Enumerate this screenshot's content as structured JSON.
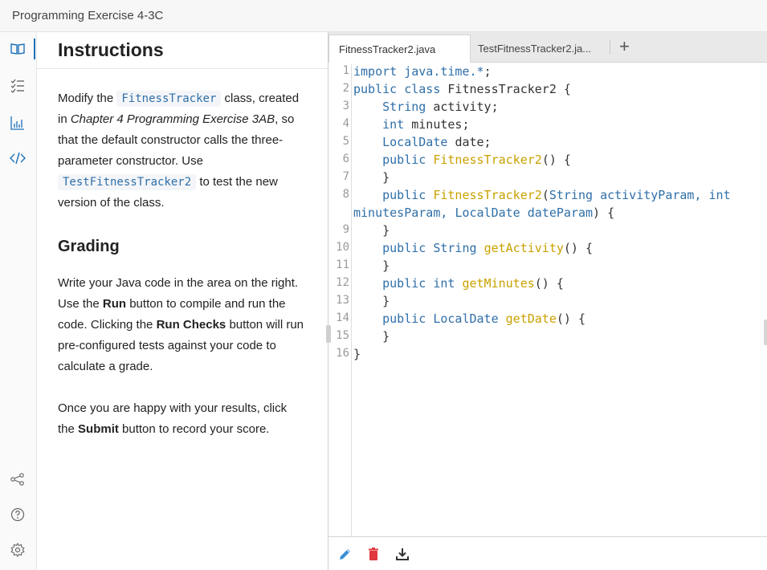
{
  "window": {
    "title": "Programming Exercise 4-3C"
  },
  "rail": {
    "icons": [
      "book-icon",
      "checklist-icon",
      "chart-icon",
      "code-icon",
      "share-icon",
      "help-icon",
      "settings-icon"
    ]
  },
  "instructions": {
    "heading": "Instructions",
    "p1_a": "Modify the ",
    "p1_code1": "FitnessTracker",
    "p1_b": " class, created in ",
    "p1_ref": "Chapter 4 Programming Exercise 3AB",
    "p1_c": ", so that the default constructor calls the three-parameter constructor. Use ",
    "p1_code2": "TestFitnessTracker2",
    "p1_d": " to test the new version of the class.",
    "grading_heading": "Grading",
    "p2_a": "Write your Java code in the area on the right. Use the ",
    "p2_run": "Run",
    "p2_b": " button to compile and run the code. Clicking the ",
    "p2_checks": "Run Checks",
    "p2_c": " button will run pre-configured tests against your code to calculate a grade.",
    "p3_a": "Once you are happy with your results, click the ",
    "p3_submit": "Submit",
    "p3_b": " button to record your score."
  },
  "editor": {
    "tabs": [
      {
        "label": "FitnessTracker2.java",
        "active": true
      },
      {
        "label": "TestFitnessTracker2.ja...",
        "active": false
      }
    ],
    "add_tab_label": "+",
    "line_numbers": [
      "1",
      "2",
      "3",
      "4",
      "5",
      "6",
      "7",
      "8",
      "9",
      "10",
      "11",
      "12",
      "13",
      "14",
      "15",
      "16"
    ],
    "lines": [
      [
        {
          "t": "import java.time.*",
          "c": "kw"
        },
        {
          "t": ";",
          "c": "pn"
        }
      ],
      [
        {
          "t": "public class ",
          "c": "kw"
        },
        {
          "t": "FitnessTracker2 {",
          "c": "pn"
        }
      ],
      [
        {
          "t": "    ",
          "c": "pn"
        },
        {
          "t": "String ",
          "c": "tp"
        },
        {
          "t": "activity;",
          "c": "pn"
        }
      ],
      [
        {
          "t": "    ",
          "c": "pn"
        },
        {
          "t": "int ",
          "c": "kw"
        },
        {
          "t": "minutes;",
          "c": "pn"
        }
      ],
      [
        {
          "t": "    ",
          "c": "pn"
        },
        {
          "t": "LocalDate ",
          "c": "tp"
        },
        {
          "t": "date;",
          "c": "pn"
        }
      ],
      [
        {
          "t": "    ",
          "c": "pn"
        },
        {
          "t": "public ",
          "c": "kw"
        },
        {
          "t": "FitnessTracker2",
          "c": "fn"
        },
        {
          "t": "() {",
          "c": "pn"
        }
      ],
      [
        {
          "t": "    }",
          "c": "pn"
        }
      ],
      [
        {
          "t": "    ",
          "c": "pn"
        },
        {
          "t": "public ",
          "c": "kw"
        },
        {
          "t": "FitnessTracker2",
          "c": "fn"
        },
        {
          "t": "(",
          "c": "pn"
        },
        {
          "t": "String ",
          "c": "tp"
        },
        {
          "t": "activityParam, ",
          "c": "kw"
        },
        {
          "t": "int",
          "c": "kw"
        }
      ],
      [
        {
          "t": "minutesParam, ",
          "c": "kw"
        },
        {
          "t": "LocalDate ",
          "c": "tp"
        },
        {
          "t": "dateParam",
          "c": "kw"
        },
        {
          "t": ") {",
          "c": "pn"
        }
      ],
      [
        {
          "t": "    }",
          "c": "pn"
        }
      ],
      [
        {
          "t": "    ",
          "c": "pn"
        },
        {
          "t": "public ",
          "c": "kw"
        },
        {
          "t": "String ",
          "c": "tp"
        },
        {
          "t": "getActivity",
          "c": "fn"
        },
        {
          "t": "() {",
          "c": "pn"
        }
      ],
      [
        {
          "t": "    }",
          "c": "pn"
        }
      ],
      [
        {
          "t": "    ",
          "c": "pn"
        },
        {
          "t": "public ",
          "c": "kw"
        },
        {
          "t": "int ",
          "c": "kw"
        },
        {
          "t": "getMinutes",
          "c": "fn"
        },
        {
          "t": "() {",
          "c": "pn"
        }
      ],
      [
        {
          "t": "    }",
          "c": "pn"
        }
      ],
      [
        {
          "t": "    ",
          "c": "pn"
        },
        {
          "t": "public ",
          "c": "kw"
        },
        {
          "t": "LocalDate ",
          "c": "tp"
        },
        {
          "t": "getDate",
          "c": "fn"
        },
        {
          "t": "() {",
          "c": "pn"
        }
      ],
      [
        {
          "t": "    }",
          "c": "pn"
        }
      ],
      [
        {
          "t": "}",
          "c": "pn"
        }
      ]
    ]
  },
  "toolbar": {
    "icons": [
      "edit-icon",
      "delete-icon",
      "download-icon"
    ]
  },
  "colors": {
    "accent": "#1b6fb8",
    "keyword": "#2f6fa8",
    "function": "#c9a100",
    "delete": "#e0393e"
  }
}
